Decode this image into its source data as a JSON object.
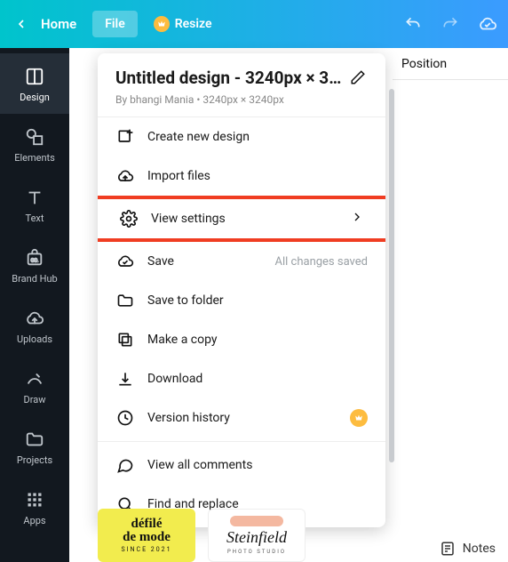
{
  "topbar": {
    "home": "Home",
    "file": "File",
    "resize": "Resize"
  },
  "sidebar": [
    {
      "label": "Design",
      "icon": "layout"
    },
    {
      "label": "Elements",
      "icon": "shapes"
    },
    {
      "label": "Text",
      "icon": "text"
    },
    {
      "label": "Brand Hub",
      "icon": "brand"
    },
    {
      "label": "Uploads",
      "icon": "cloud-up"
    },
    {
      "label": "Draw",
      "icon": "pencil-curve"
    },
    {
      "label": "Projects",
      "icon": "folder"
    },
    {
      "label": "Apps",
      "icon": "grid"
    }
  ],
  "right": {
    "position": "Position"
  },
  "dropdown": {
    "title": "Untitled design - 3240px × 3...",
    "byline": "By bhangi Mania • 3240px × 3240px",
    "items": {
      "create": "Create new design",
      "import": "Import files",
      "viewsettings": "View settings",
      "save": "Save",
      "save_status": "All changes saved",
      "savefolder": "Save to folder",
      "copy": "Make a copy",
      "download": "Download",
      "version": "Version history",
      "comments": "View all comments",
      "find": "Find and replace"
    }
  },
  "thumbs": {
    "a_line1": "défilé",
    "a_line2": "de mode",
    "a_sub": "SINCE 2021",
    "b_line1": "Steinfield",
    "b_sub": "PHOTO STUDIO"
  },
  "notes": {
    "label": "Notes"
  }
}
